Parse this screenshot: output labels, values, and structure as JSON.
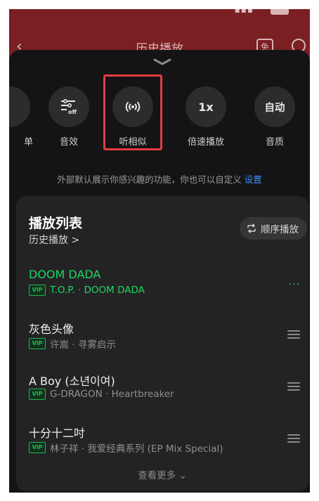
{
  "header": {
    "title": "历史播放",
    "free_badge": "免"
  },
  "tools": [
    {
      "label": "单",
      "icon": "list-icon"
    },
    {
      "label": "音效",
      "icon": "equalizer-off-icon",
      "icon_text": "off"
    },
    {
      "label": "听相似",
      "icon": "broadcast-icon"
    },
    {
      "label": "倍速播放",
      "icon": "speed-icon",
      "icon_text": "1x"
    },
    {
      "label": "音质",
      "icon": "quality-icon",
      "icon_text": "自动"
    }
  ],
  "hint": {
    "text": "外部默认展示你感兴趣的功能，你也可以自定义",
    "link": "设置"
  },
  "playlist": {
    "title": "播放列表",
    "subtitle": "历史播放 >",
    "order_button": "顺序播放",
    "vip_label": "VIP",
    "songs": [
      {
        "name": "DOOM DADA",
        "artist": "T.O.P. · DOOM DADA",
        "playing": true
      },
      {
        "name": "灰色头像",
        "artist": "许嵩 · 寻雾启示",
        "playing": false
      },
      {
        "name": "A Boy (소년이여)",
        "artist": "G-DRAGON · Heartbreaker",
        "playing": false
      },
      {
        "name": "十分十二吋",
        "artist": "林子祥 · 我爱经典系列 (EP Mix Special)",
        "playing": false
      }
    ],
    "more": "查看更多 ⌄"
  },
  "colors": {
    "accent_green": "#1ed760",
    "highlight_red": "#e23c42",
    "link_blue": "#3d8eff"
  }
}
